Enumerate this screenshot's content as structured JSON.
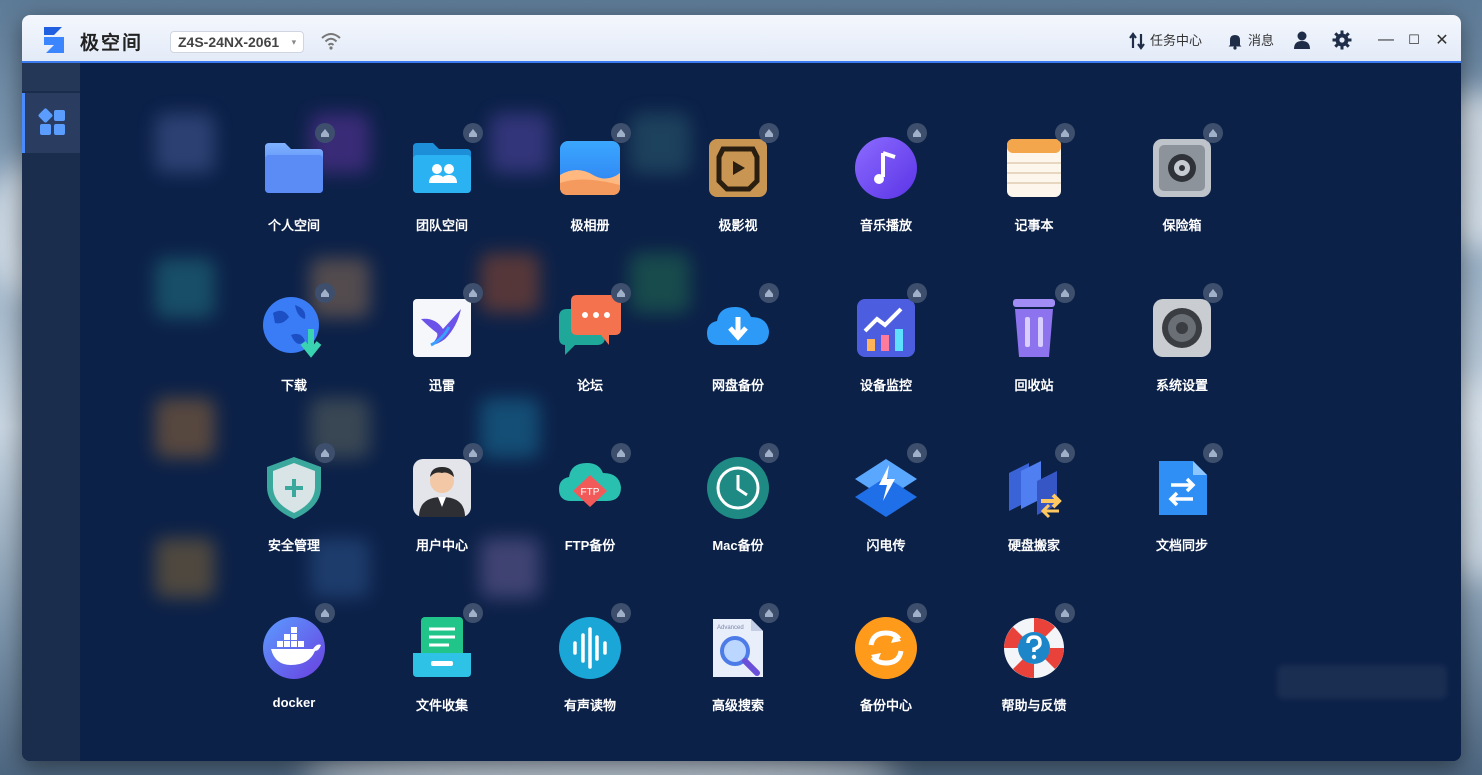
{
  "window": {
    "brand": "极空间",
    "device_name": "Z4S-24NX-2061",
    "device_caret": "▾"
  },
  "toolbar": {
    "tasks_label": "任务中心",
    "messages_label": "消息"
  },
  "window_controls": {
    "minimize": "—",
    "maximize": "☐",
    "close": "✕"
  },
  "apps": [
    {
      "label": "个人空间",
      "icon": "folder-icon"
    },
    {
      "label": "团队空间",
      "icon": "team-folder-icon"
    },
    {
      "label": "极相册",
      "icon": "photo-album-icon"
    },
    {
      "label": "极影视",
      "icon": "video-icon"
    },
    {
      "label": "音乐播放",
      "icon": "music-icon"
    },
    {
      "label": "记事本",
      "icon": "notepad-icon"
    },
    {
      "label": "保险箱",
      "icon": "safe-icon"
    },
    {
      "label": "下载",
      "icon": "download-globe-icon"
    },
    {
      "label": "迅雷",
      "icon": "thunder-bird-icon"
    },
    {
      "label": "论坛",
      "icon": "forum-chat-icon"
    },
    {
      "label": "网盘备份",
      "icon": "cloud-backup-icon"
    },
    {
      "label": "设备监控",
      "icon": "monitor-chart-icon"
    },
    {
      "label": "回收站",
      "icon": "trash-icon"
    },
    {
      "label": "系统设置",
      "icon": "settings-gear-icon"
    },
    {
      "label": "安全管理",
      "icon": "shield-icon"
    },
    {
      "label": "用户中心",
      "icon": "user-center-icon"
    },
    {
      "label": "FTP备份",
      "icon": "ftp-cloud-icon"
    },
    {
      "label": "Mac备份",
      "icon": "time-machine-icon"
    },
    {
      "label": "闪电传",
      "icon": "lightning-icon"
    },
    {
      "label": "硬盘搬家",
      "icon": "disk-move-icon"
    },
    {
      "label": "文档同步",
      "icon": "doc-sync-icon"
    },
    {
      "label": "docker",
      "icon": "docker-whale-icon"
    },
    {
      "label": "文件收集",
      "icon": "file-collect-icon"
    },
    {
      "label": "有声读物",
      "icon": "audiobook-icon"
    },
    {
      "label": "高级搜索",
      "icon": "advanced-search-icon"
    },
    {
      "label": "备份中心",
      "icon": "backup-center-icon"
    },
    {
      "label": "帮助与反馈",
      "icon": "help-lifebuoy-icon"
    }
  ],
  "search_doc_text": "Advanced",
  "ftp_text": "FTP",
  "colors": {
    "accent": "#3d7cf0",
    "main_bg": "#0c2148",
    "sidebar_bg": "#1b2d4d"
  }
}
